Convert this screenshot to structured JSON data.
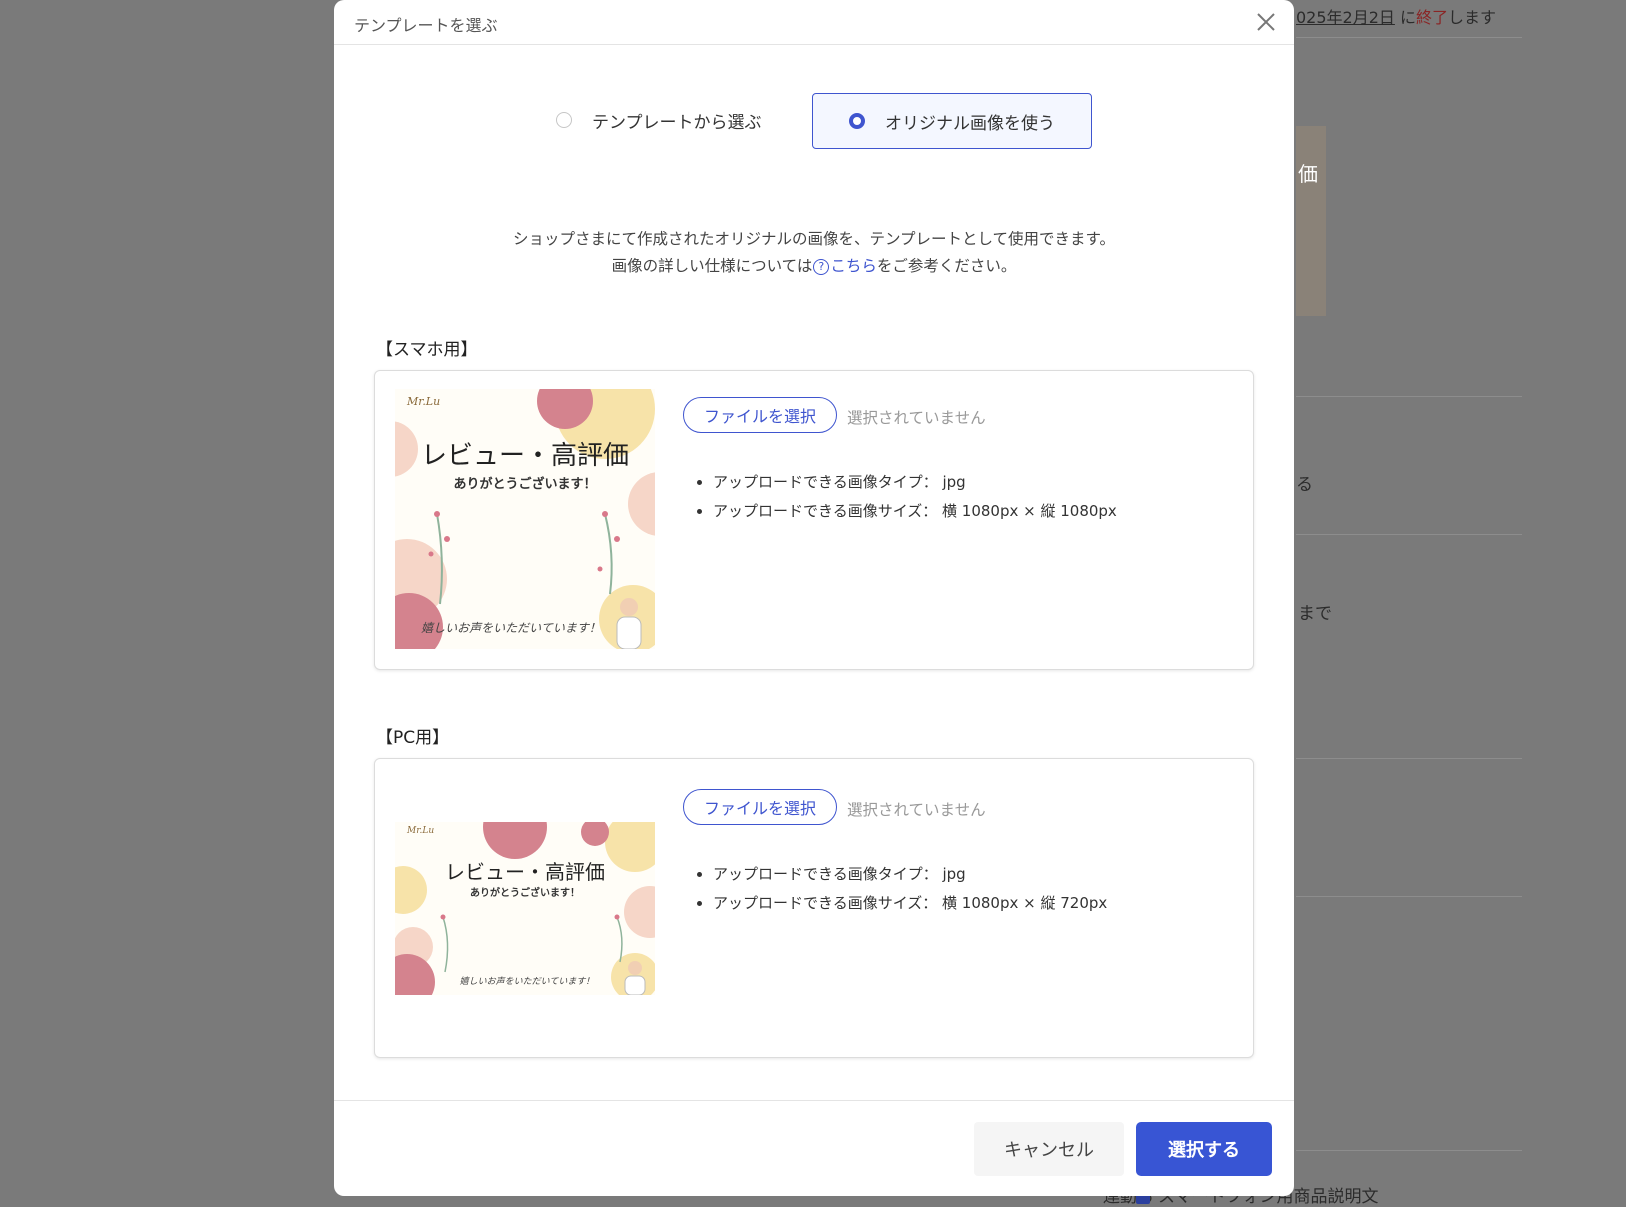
{
  "background": {
    "notice_date": "025年2月2日",
    "notice_mid": " に",
    "notice_end": "終了",
    "notice_tail": "します",
    "frag_price": "価",
    "frag_ru": "る",
    "frag_made": "まで",
    "bottom_left": "一連動る",
    "bottom_right": "スマートフォン用商品説明文"
  },
  "modal": {
    "title": "テンプレートを選ぶ",
    "close_icon": "close-icon",
    "options": {
      "template": "テンプレートから選ぶ",
      "original": "オリジナル画像を使う",
      "selected": "original"
    },
    "description": {
      "line1": "ショップさまにて作成されたオリジナルの画像を、テンプレートとして使用できます。",
      "line2_before": "画像の詳しい仕様については",
      "help_icon": "?",
      "link": "こちら",
      "line2_after": "をご参考ください。"
    },
    "sp": {
      "label": "【スマホ用】",
      "file_button": "ファイルを選択",
      "file_status": "選択されていません",
      "specs": [
        "アップロードできる画像タイプ： jpg",
        "アップロードできる画像サイズ： 横 1080px × 縦 1080px"
      ]
    },
    "pc": {
      "label": "【PC用】",
      "file_button": "ファイルを選択",
      "file_status": "選択されていません",
      "specs": [
        "アップロードできる画像タイプ： jpg",
        "アップロードできる画像サイズ： 横 1080px × 縦 720px"
      ]
    },
    "preview": {
      "title": "レビュー・高評価",
      "subtitle": "ありがとうございます！",
      "script": "嬉しいお声をいただいています！",
      "logo": "Mr.Lu"
    },
    "footer": {
      "cancel": "キャンセル",
      "select": "選択する"
    },
    "colors": {
      "accent": "#3f55cf",
      "primary_button": "#3855d4",
      "blob_rose": "#d4838e",
      "blob_cream": "#f7e3a9",
      "blob_peach": "#f6d6c8"
    }
  }
}
